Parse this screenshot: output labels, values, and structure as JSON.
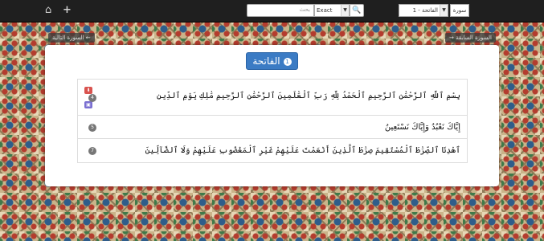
{
  "topbar": {
    "home_icon": "home-icon",
    "add_icon": "plus-icon",
    "search_placeholder": "بحث",
    "search_mode": "Exact",
    "search_icon": "search-icon",
    "surah_selected": "الفاتحة - 1",
    "surah_label": "سورة"
  },
  "nav": {
    "next_surah": "السورة التالية ←",
    "prev_surah": "→ السورة السابقة"
  },
  "surah": {
    "title": "الفاتحة",
    "number": "1"
  },
  "verses": [
    {
      "number": "4",
      "text": "بِسْمِ ٱللَّهِ ٱلرَّحْمَٰنِ ٱلرَّحِيمِ ٱلْحَمْدُ لِلَّهِ رَبِّ ٱلْعَٰلَمِينَ ٱلرَّحْمَٰنِ ٱلرَّحِيمِ مَٰلِكِ يَوْمِ ٱلدِّينِ"
    },
    {
      "number": "5",
      "text": "إِيَّاكَ نَعْبُدُ وَإِيَّاكَ نَسْتَعِينُ"
    },
    {
      "number": "7",
      "text": "ٱهْدِنَا ٱلصِّرَٰطَ ٱلْمُسْتَقِيمَ صِرَٰطَ ٱلَّذِينَ أَنْعَمْتَ عَلَيْهِمْ غَيْرِ ٱلْمَغْضُوبِ عَلَيْهِمْ وَلَا ٱلضَّآلِّينَ"
    }
  ],
  "verse_actions": [
    "download-icon",
    "image-icon"
  ],
  "colors": {
    "accent": "#3b7bc4",
    "download": "#d9534f",
    "image": "#7a6fd1"
  }
}
